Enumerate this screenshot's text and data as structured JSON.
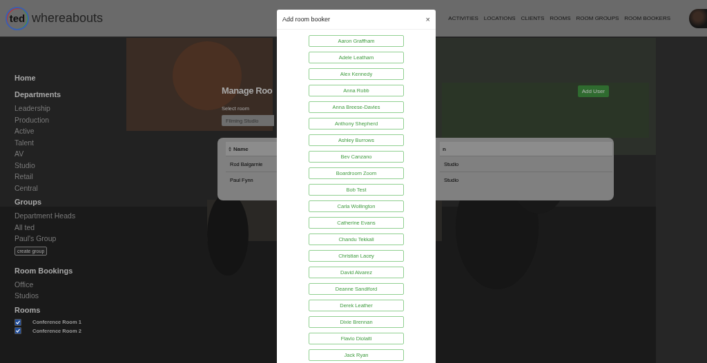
{
  "header": {
    "logo": {
      "mark": "ted",
      "name": "whereabouts"
    },
    "nav": [
      "ACTIVITIES",
      "LOCATIONS",
      "CLIENTS",
      "ROOMS",
      "ROOM GROUPS",
      "ROOM BOOKERS"
    ]
  },
  "sidebar": [
    {
      "heading": "Home"
    },
    {
      "heading": "Departments",
      "items": [
        {
          "label": "Leadership"
        },
        {
          "label": "Production"
        },
        {
          "label": "Active"
        },
        {
          "label": "Talent"
        },
        {
          "label": "AV"
        },
        {
          "label": "Studio"
        },
        {
          "label": "Retail"
        },
        {
          "label": "Central"
        }
      ]
    },
    {
      "heading": "Groups",
      "items": [
        {
          "label": "Department Heads"
        },
        {
          "label": "All ted"
        },
        {
          "label": "Paul's Group"
        }
      ],
      "button": "create group"
    },
    {
      "heading": "Room Bookings",
      "items": [
        {
          "label": "Office"
        },
        {
          "label": "Studios"
        }
      ]
    },
    {
      "heading": "Rooms",
      "items": [
        {
          "label": "Conference Room 1",
          "checked": true
        },
        {
          "label": "Conference Room 2",
          "checked": true
        }
      ]
    }
  ],
  "main": {
    "title": "Manage Roo",
    "select_label": "Select room",
    "select_value": "Filming Studio",
    "add_button": "Add User",
    "table": {
      "columns": [
        "Name",
        "n"
      ],
      "rows": [
        [
          "Rod Balgarnie",
          "Studio"
        ],
        [
          "Paul Fynn",
          "Studio"
        ]
      ]
    }
  },
  "modal": {
    "title": "Add room booker",
    "close": "×",
    "bookers": [
      "Aaron Graffham",
      "Adele Leatham",
      "Alex Kennedy",
      "Anna Robb",
      "Anna Breese-Davies",
      "Anthony Shepherd",
      "Ashley Burrows",
      "Bev Canzano",
      "Boardroom Zoom",
      "Bob Test",
      "Carla Wollington",
      "Catherine Evans",
      "Chandu Tekkali",
      "Christian Lacey",
      "David Alvarez",
      "Deanne Sandiford",
      "Derek Leather",
      "Dixie Brennan",
      "Flavio Diolaiti",
      "Jack Ryan"
    ]
  }
}
